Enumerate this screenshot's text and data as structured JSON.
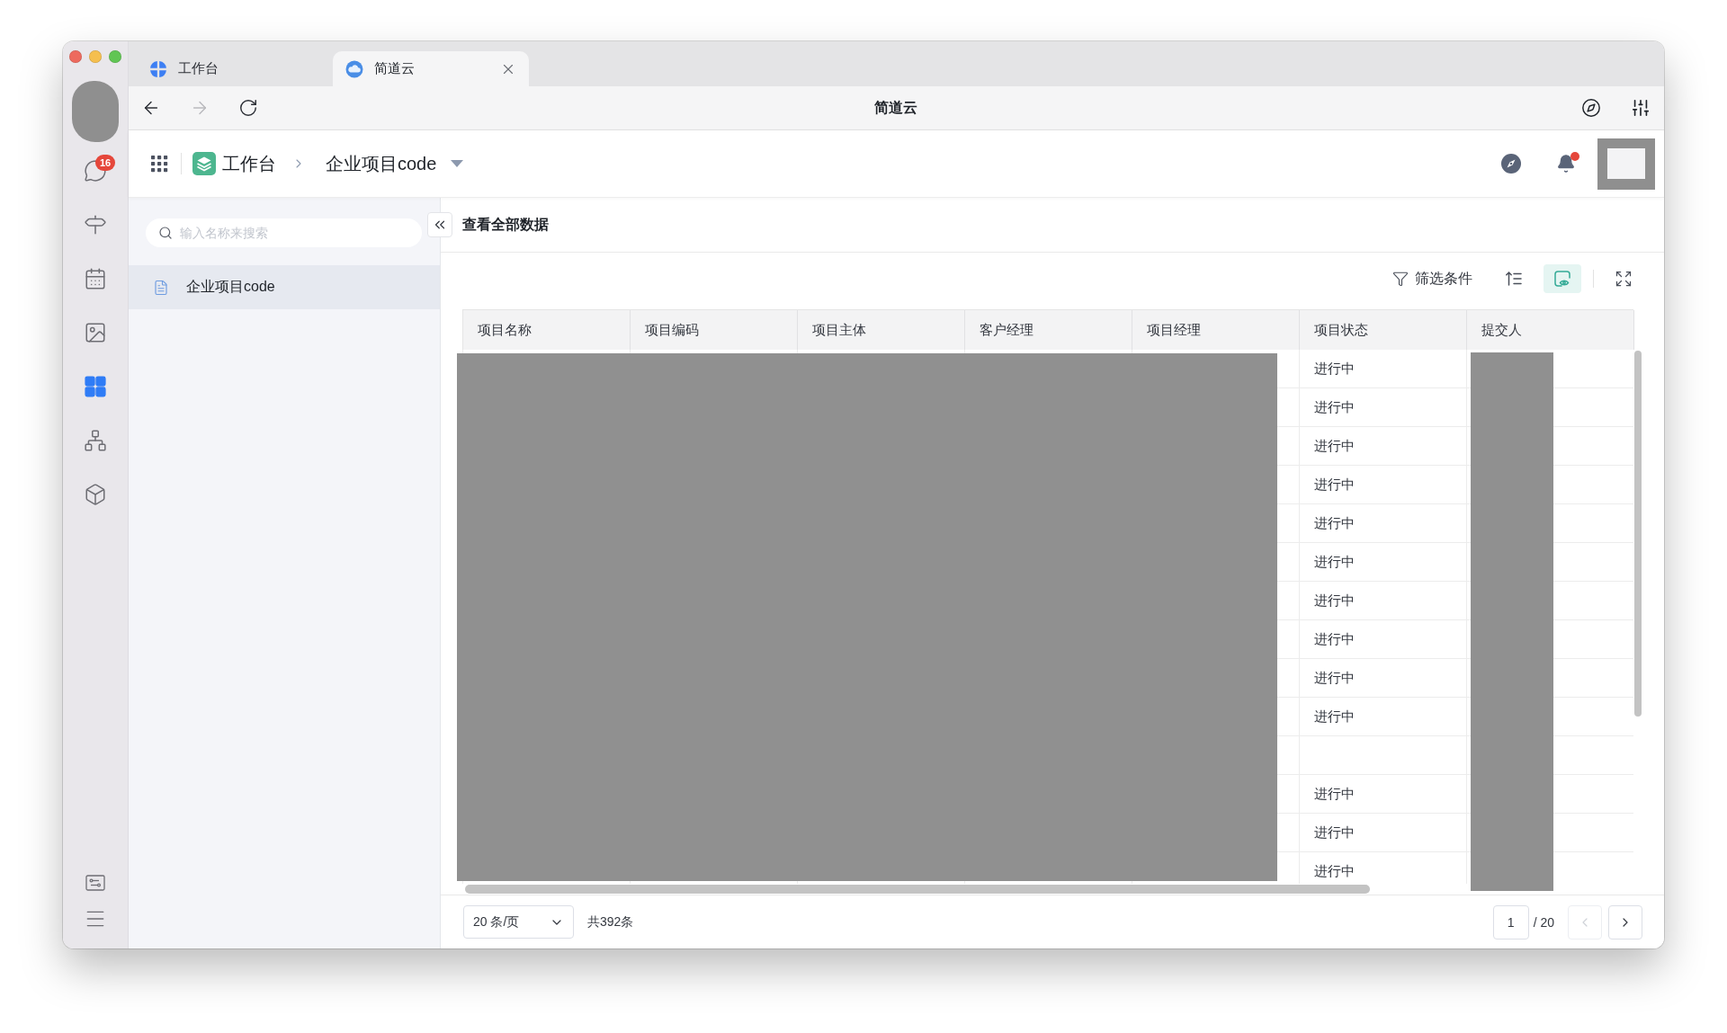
{
  "browser_tabs": [
    {
      "kind": "workbench",
      "label": "工作台",
      "selected": false
    },
    {
      "kind": "cloud",
      "label": "简道云",
      "selected": true
    }
  ],
  "toolbar": {
    "nav": [
      {
        "kind": "back",
        "disabled": false
      },
      {
        "kind": "forward",
        "disabled": true
      },
      {
        "kind": "reload",
        "disabled": false
      }
    ],
    "title": "简道云"
  },
  "dock": {
    "items": [
      {
        "kind": "chat",
        "badge": "16",
        "selected": false
      },
      {
        "kind": "signpost",
        "selected": false
      },
      {
        "kind": "calendar",
        "selected": false
      },
      {
        "kind": "image",
        "selected": false
      },
      {
        "kind": "apps",
        "selected": true
      },
      {
        "kind": "network",
        "selected": false
      },
      {
        "kind": "cube",
        "selected": false
      }
    ],
    "bottom_items": [
      {
        "kind": "sliders_card"
      },
      {
        "kind": "menu"
      }
    ]
  },
  "app_header": {
    "breadcrumb": [
      {
        "kind": "app",
        "label": "工作台"
      },
      {
        "kind": "form",
        "label": "企业项目code"
      }
    ],
    "notification_dot": true
  },
  "sidebar": {
    "search": {
      "placeholder": "输入名称来搜索"
    },
    "items": [
      {
        "label": "企业项目code",
        "selected": true
      }
    ]
  },
  "main": {
    "title": "查看全部数据",
    "tools": [
      {
        "kind": "filter",
        "label": "筛选条件",
        "selected": false
      },
      {
        "kind": "sort",
        "selected": false
      },
      {
        "kind": "preview",
        "selected": true
      },
      {
        "kind": "fullscreen",
        "selected": false
      }
    ]
  },
  "table": {
    "columns": [
      {
        "kind": "name",
        "label": "项目名称"
      },
      {
        "kind": "code",
        "label": "项目编码"
      },
      {
        "kind": "entity",
        "label": "项目主体"
      },
      {
        "kind": "client_manager",
        "label": "客户经理"
      },
      {
        "kind": "project_manager",
        "label": "项目经理"
      },
      {
        "kind": "status",
        "label": "项目状态"
      },
      {
        "kind": "submitter",
        "label": "提交人"
      }
    ],
    "rows": [
      {
        "status": "进行中"
      },
      {
        "status": "进行中"
      },
      {
        "status": "进行中"
      },
      {
        "status": "进行中"
      },
      {
        "status": "进行中"
      },
      {
        "status": "进行中"
      },
      {
        "status": "进行中"
      },
      {
        "status": "进行中"
      },
      {
        "status": "进行中"
      },
      {
        "status": "进行中"
      },
      {},
      {
        "status": "进行中"
      },
      {
        "status": "进行中"
      },
      {
        "status": "进行中"
      }
    ]
  },
  "pagination": {
    "page_size": "20 条/页",
    "total": "共392条",
    "page": "1",
    "page_count": "/ 20",
    "buttons": [
      {
        "kind": "previous",
        "disabled": true
      },
      {
        "kind": "next",
        "disabled": false
      }
    ]
  }
}
